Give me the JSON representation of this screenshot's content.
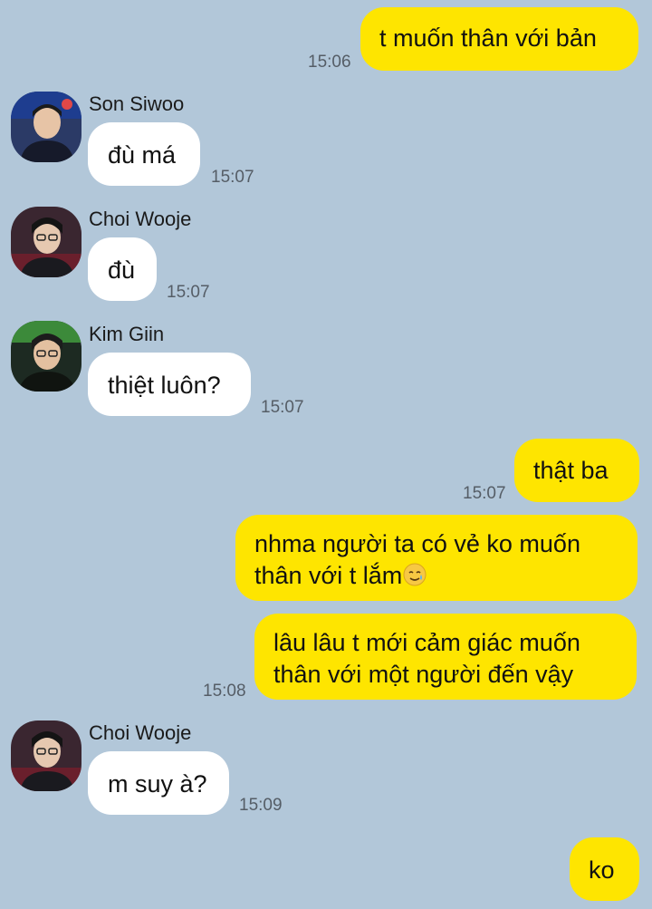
{
  "messages": [
    {
      "id": "m1",
      "side": "mine",
      "lines": [
        "t muốn thân với bản"
      ],
      "time": "15:06"
    },
    {
      "id": "m2",
      "side": "theirs",
      "sender": "Son Siwoo",
      "lines": [
        "đù má"
      ],
      "time": "15:07"
    },
    {
      "id": "m3",
      "side": "theirs",
      "sender": "Choi Wooje",
      "lines": [
        "đù"
      ],
      "time": "15:07"
    },
    {
      "id": "m4",
      "side": "theirs",
      "sender": "Kim Giin",
      "lines": [
        "thiệt luôn?"
      ],
      "time": "15:07"
    },
    {
      "id": "m5",
      "side": "mine",
      "lines": [
        "thật ba"
      ],
      "time": "15:07"
    },
    {
      "id": "m6",
      "side": "mine",
      "lines": [
        "nhma người ta có vẻ ko muốn",
        "thân với t lắm"
      ],
      "emoji": "smiling-face-with-tear",
      "time": ""
    },
    {
      "id": "m7",
      "side": "mine",
      "lines": [
        "lâu lâu t mới cảm giác muốn",
        "thân với một người đến vậy"
      ],
      "time": "15:08"
    },
    {
      "id": "m8",
      "side": "theirs",
      "sender": "Choi Wooje",
      "lines": [
        "m suy à?"
      ],
      "time": "15:09"
    },
    {
      "id": "m9",
      "side": "mine",
      "lines": [
        "ko"
      ],
      "time": ""
    }
  ],
  "colors": {
    "background": "#b2c7d9",
    "mine_bubble": "#fee500",
    "theirs_bubble": "#ffffff",
    "time_text": "#555d66"
  },
  "icons": {
    "avatar": "profile-photo",
    "emoji": "smiling-face-with-tear"
  }
}
